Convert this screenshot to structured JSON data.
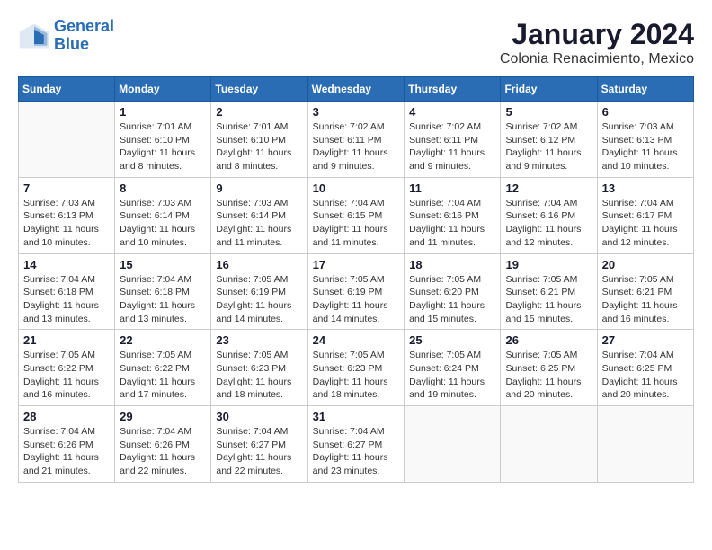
{
  "header": {
    "logo_line1": "General",
    "logo_line2": "Blue",
    "month": "January 2024",
    "location": "Colonia Renacimiento, Mexico"
  },
  "weekdays": [
    "Sunday",
    "Monday",
    "Tuesday",
    "Wednesday",
    "Thursday",
    "Friday",
    "Saturday"
  ],
  "weeks": [
    [
      {
        "day": "",
        "info": ""
      },
      {
        "day": "1",
        "info": "Sunrise: 7:01 AM\nSunset: 6:10 PM\nDaylight: 11 hours\nand 8 minutes."
      },
      {
        "day": "2",
        "info": "Sunrise: 7:01 AM\nSunset: 6:10 PM\nDaylight: 11 hours\nand 8 minutes."
      },
      {
        "day": "3",
        "info": "Sunrise: 7:02 AM\nSunset: 6:11 PM\nDaylight: 11 hours\nand 9 minutes."
      },
      {
        "day": "4",
        "info": "Sunrise: 7:02 AM\nSunset: 6:11 PM\nDaylight: 11 hours\nand 9 minutes."
      },
      {
        "day": "5",
        "info": "Sunrise: 7:02 AM\nSunset: 6:12 PM\nDaylight: 11 hours\nand 9 minutes."
      },
      {
        "day": "6",
        "info": "Sunrise: 7:03 AM\nSunset: 6:13 PM\nDaylight: 11 hours\nand 10 minutes."
      }
    ],
    [
      {
        "day": "7",
        "info": "Sunrise: 7:03 AM\nSunset: 6:13 PM\nDaylight: 11 hours\nand 10 minutes."
      },
      {
        "day": "8",
        "info": "Sunrise: 7:03 AM\nSunset: 6:14 PM\nDaylight: 11 hours\nand 10 minutes."
      },
      {
        "day": "9",
        "info": "Sunrise: 7:03 AM\nSunset: 6:14 PM\nDaylight: 11 hours\nand 11 minutes."
      },
      {
        "day": "10",
        "info": "Sunrise: 7:04 AM\nSunset: 6:15 PM\nDaylight: 11 hours\nand 11 minutes."
      },
      {
        "day": "11",
        "info": "Sunrise: 7:04 AM\nSunset: 6:16 PM\nDaylight: 11 hours\nand 11 minutes."
      },
      {
        "day": "12",
        "info": "Sunrise: 7:04 AM\nSunset: 6:16 PM\nDaylight: 11 hours\nand 12 minutes."
      },
      {
        "day": "13",
        "info": "Sunrise: 7:04 AM\nSunset: 6:17 PM\nDaylight: 11 hours\nand 12 minutes."
      }
    ],
    [
      {
        "day": "14",
        "info": "Sunrise: 7:04 AM\nSunset: 6:18 PM\nDaylight: 11 hours\nand 13 minutes."
      },
      {
        "day": "15",
        "info": "Sunrise: 7:04 AM\nSunset: 6:18 PM\nDaylight: 11 hours\nand 13 minutes."
      },
      {
        "day": "16",
        "info": "Sunrise: 7:05 AM\nSunset: 6:19 PM\nDaylight: 11 hours\nand 14 minutes."
      },
      {
        "day": "17",
        "info": "Sunrise: 7:05 AM\nSunset: 6:19 PM\nDaylight: 11 hours\nand 14 minutes."
      },
      {
        "day": "18",
        "info": "Sunrise: 7:05 AM\nSunset: 6:20 PM\nDaylight: 11 hours\nand 15 minutes."
      },
      {
        "day": "19",
        "info": "Sunrise: 7:05 AM\nSunset: 6:21 PM\nDaylight: 11 hours\nand 15 minutes."
      },
      {
        "day": "20",
        "info": "Sunrise: 7:05 AM\nSunset: 6:21 PM\nDaylight: 11 hours\nand 16 minutes."
      }
    ],
    [
      {
        "day": "21",
        "info": "Sunrise: 7:05 AM\nSunset: 6:22 PM\nDaylight: 11 hours\nand 16 minutes."
      },
      {
        "day": "22",
        "info": "Sunrise: 7:05 AM\nSunset: 6:22 PM\nDaylight: 11 hours\nand 17 minutes."
      },
      {
        "day": "23",
        "info": "Sunrise: 7:05 AM\nSunset: 6:23 PM\nDaylight: 11 hours\nand 18 minutes."
      },
      {
        "day": "24",
        "info": "Sunrise: 7:05 AM\nSunset: 6:23 PM\nDaylight: 11 hours\nand 18 minutes."
      },
      {
        "day": "25",
        "info": "Sunrise: 7:05 AM\nSunset: 6:24 PM\nDaylight: 11 hours\nand 19 minutes."
      },
      {
        "day": "26",
        "info": "Sunrise: 7:05 AM\nSunset: 6:25 PM\nDaylight: 11 hours\nand 20 minutes."
      },
      {
        "day": "27",
        "info": "Sunrise: 7:04 AM\nSunset: 6:25 PM\nDaylight: 11 hours\nand 20 minutes."
      }
    ],
    [
      {
        "day": "28",
        "info": "Sunrise: 7:04 AM\nSunset: 6:26 PM\nDaylight: 11 hours\nand 21 minutes."
      },
      {
        "day": "29",
        "info": "Sunrise: 7:04 AM\nSunset: 6:26 PM\nDaylight: 11 hours\nand 22 minutes."
      },
      {
        "day": "30",
        "info": "Sunrise: 7:04 AM\nSunset: 6:27 PM\nDaylight: 11 hours\nand 22 minutes."
      },
      {
        "day": "31",
        "info": "Sunrise: 7:04 AM\nSunset: 6:27 PM\nDaylight: 11 hours\nand 23 minutes."
      },
      {
        "day": "",
        "info": ""
      },
      {
        "day": "",
        "info": ""
      },
      {
        "day": "",
        "info": ""
      }
    ]
  ]
}
